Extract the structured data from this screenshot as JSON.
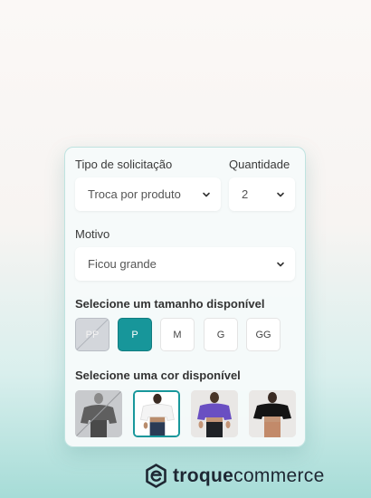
{
  "form": {
    "request_type_label": "Tipo de solicitação",
    "request_type_value": "Troca por produto",
    "quantity_label": "Quantidade",
    "quantity_value": "2",
    "reason_label": "Motivo",
    "reason_value": "Ficou grande",
    "size_section_title": "Selecione um tamanho disponível",
    "sizes": [
      {
        "label": "PP",
        "state": "unavailable"
      },
      {
        "label": "P",
        "state": "selected"
      },
      {
        "label": "M",
        "state": "available"
      },
      {
        "label": "G",
        "state": "available"
      },
      {
        "label": "GG",
        "state": "available"
      }
    ],
    "color_section_title": "Selecione uma cor disponível",
    "colors": [
      {
        "name": "gray",
        "state": "unavailable",
        "swatch": "#6b6b6b"
      },
      {
        "name": "white",
        "state": "selected",
        "swatch": "#f2f2f2"
      },
      {
        "name": "purple",
        "state": "available",
        "swatch": "#6a4fc2"
      },
      {
        "name": "black",
        "state": "available",
        "swatch": "#141414"
      }
    ]
  },
  "brand": {
    "name_bold": "troque",
    "name_rest": "commerce",
    "logo_icon": "e-logo-icon"
  },
  "colors": {
    "accent": "#17969a",
    "brand_dark": "#1e2733"
  }
}
